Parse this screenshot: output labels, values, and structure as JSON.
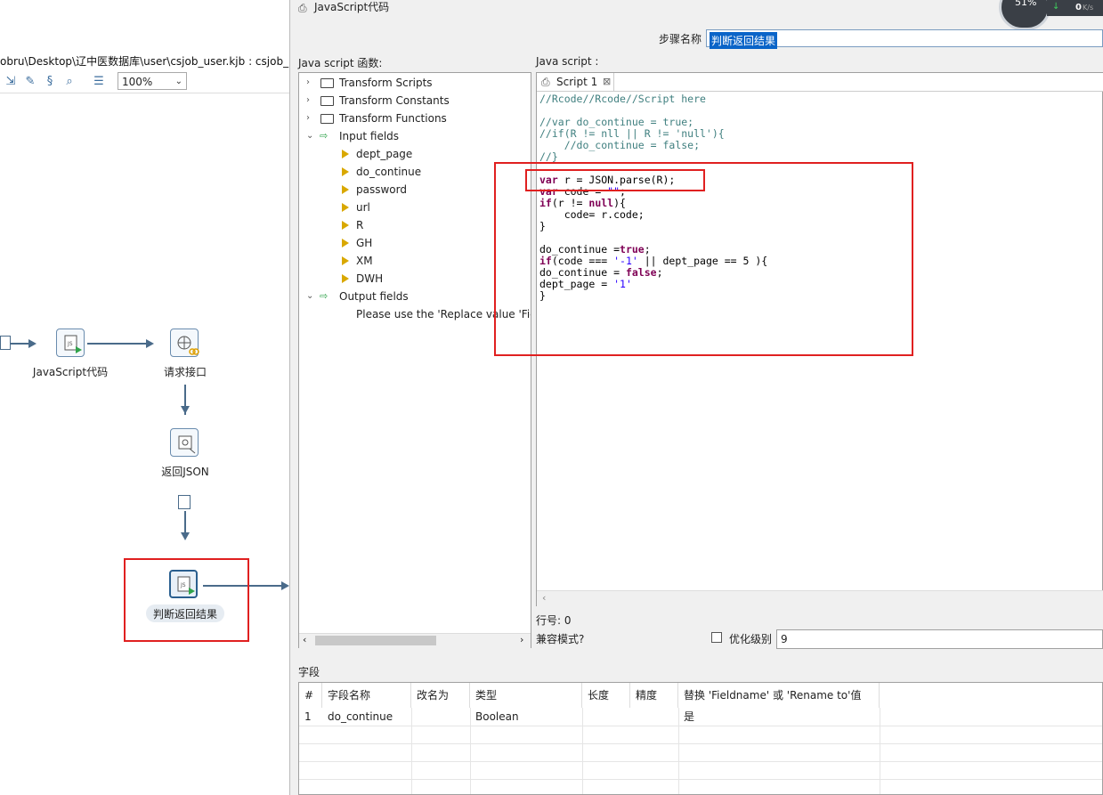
{
  "canvas": {
    "path_text": "obru\\Desktop\\辽中医数据库\\user\\csjob_user.kjb : csjob_u",
    "zoom": "100%",
    "steps": {
      "js_code": "JavaScript代码",
      "request_api": "请求接口",
      "return_json": "返回JSON",
      "judge_result": "判断返回结果"
    }
  },
  "dialog": {
    "title": "JavaScript代码",
    "step_name_label": "步骤名称",
    "step_name_value": "判断返回结果",
    "functions_label": "Java script 函数:",
    "script_label": "Java script :",
    "tree": {
      "transform_scripts": "Transform Scripts",
      "transform_constants": "Transform Constants",
      "transform_functions": "Transform Functions",
      "input_fields": "Input fields",
      "inputs": [
        "dept_page",
        "do_continue",
        "password",
        "url",
        "R",
        "GH",
        "XM",
        "DWH"
      ],
      "output_fields": "Output fields",
      "output_hint": "Please use the 'Replace value 'Fiel"
    },
    "tab": {
      "label": "Script 1",
      "close": "⊠"
    },
    "code": {
      "l1": "//Rcode//Rcode//Script here",
      "l2": "//var do_continue = true;",
      "l3": "//if(R != nll || R != 'null'){",
      "l4": "    //do_continue = false;",
      "l5": "//}",
      "l6_kw": "var",
      "l6_rest": " r = JSON.parse(R);",
      "l7_kw": "var",
      "l7_rest": " code = ",
      "l7_str": "\"\"",
      "l7_end": ";",
      "l8_kw": "if",
      "l8_mid": "(r != ",
      "l8_kw2": "null",
      "l8_end": "){",
      "l9": "    code= r.code;",
      "l10": "}",
      "l11_a": "do_continue =",
      "l11_kw": "true",
      "l11_end": ";",
      "l12_kw": "if",
      "l12_a": "(code === ",
      "l12_str": "'-1'",
      "l12_b": " || dept_page == 5 ){",
      "l13_a": "do_continue = ",
      "l13_kw": "false",
      "l13_end": ";",
      "l14_a": "dept_page = ",
      "l14_str": "'1'",
      "l15": "}"
    },
    "line_label": "行号: 0",
    "compat_label": "兼容模式?",
    "opt_label": "优化级别",
    "opt_value": "9",
    "fields_label": "字段",
    "table": {
      "headers": [
        "#",
        "字段名称",
        "改名为",
        "类型",
        "长度",
        "精度",
        "替换 'Fieldname' 或 'Rename to'值"
      ],
      "header_wrap": "是",
      "rows": [
        {
          "num": "1",
          "name": "do_continue",
          "rename": "",
          "type": "Boolean",
          "length": "",
          "precision": "",
          "replace": ""
        }
      ]
    }
  },
  "speed": {
    "value": "0",
    "unit": "K/s",
    "percent": "51%"
  }
}
